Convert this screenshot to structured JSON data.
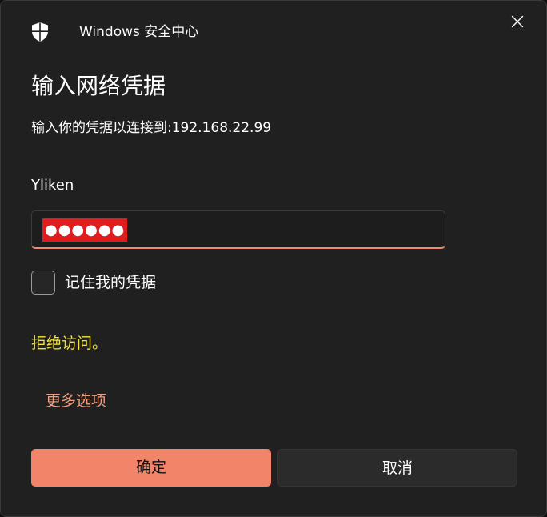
{
  "window": {
    "app_title": "Windows 安全中心",
    "icons": {
      "app": "shield-icon",
      "close": "close-icon"
    }
  },
  "dialog": {
    "heading": "输入网络凭据",
    "subtitle": "输入你的凭据以连接到:192.168.22.99",
    "username": "Yliken",
    "password_mask": "●●●●●●",
    "remember_label": "记住我的凭据",
    "remember_checked": false,
    "error_text": "拒绝访问。",
    "more_options": "更多选项"
  },
  "buttons": {
    "ok_label": "确定",
    "cancel_label": "取消"
  },
  "colors": {
    "accent": "#f28469",
    "error": "#f2e33a",
    "link": "#f0a07e",
    "password_highlight": "#e01c1c",
    "background": "#202020"
  }
}
